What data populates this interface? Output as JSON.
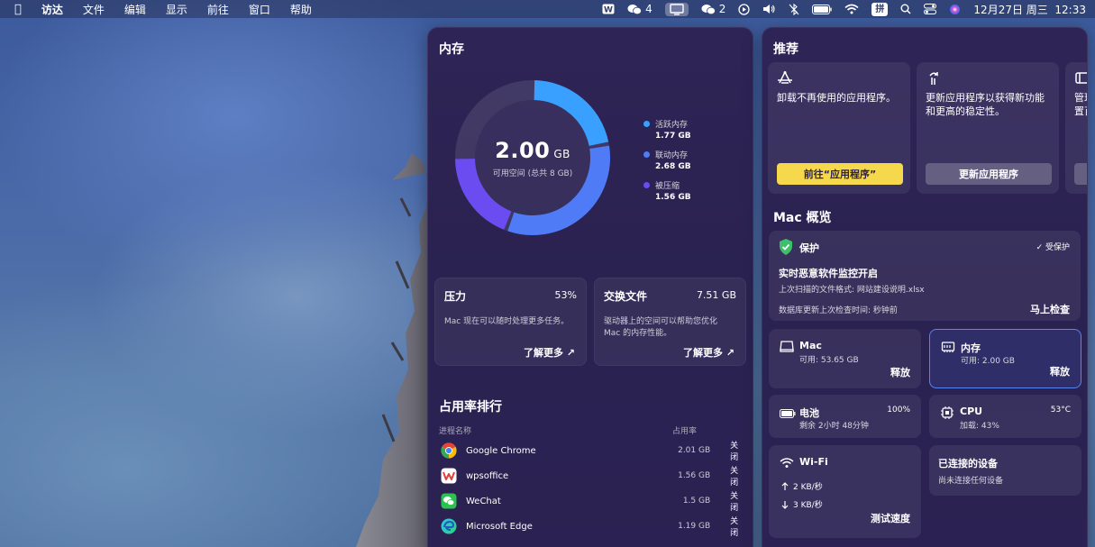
{
  "menubar": {
    "app_name": "访达",
    "menus": [
      "文件",
      "编辑",
      "显示",
      "前往",
      "窗口",
      "帮助"
    ],
    "wechat_count_1": "4",
    "wechat_count_2": "2",
    "input_method": "拼",
    "datetime": "12月27日 周三  12:33"
  },
  "memory": {
    "title": "内存",
    "available_value": "2.00",
    "available_unit": "GB",
    "available_caption": "可用空间 (总共 8 GB)",
    "legend": [
      {
        "label": "活跃内存",
        "value": "1.77 GB",
        "color": "#3aa0ff"
      },
      {
        "label": "联动内存",
        "value": "2.68 GB",
        "color": "#4f7cf6"
      },
      {
        "label": "被压缩",
        "value": "1.56 GB",
        "color": "#6a4cf0"
      }
    ],
    "gauge": {
      "active_gb": 1.77,
      "wired_gb": 2.68,
      "compressed_gb": 1.56,
      "free_gb": 2.0,
      "total_gb": 8
    }
  },
  "pressure": {
    "title": "压力",
    "value": "53%",
    "desc": "Mac 现在可以随时处理更多任务。",
    "link": "了解更多 ↗"
  },
  "swap": {
    "title": "交换文件",
    "value": "7.51 GB",
    "desc_line1": "驱动器上的空间可以帮助您优化",
    "desc_line2": "Mac 的内存性能。",
    "link": "了解更多 ↗"
  },
  "ranking": {
    "title": "占用率排行",
    "col_name": "进程名称",
    "col_usage": "占用率",
    "rows": [
      {
        "name": "Google Chrome",
        "usage": "2.01 GB",
        "action": "关闭",
        "icon": "chrome-icon"
      },
      {
        "name": "wpsoffice",
        "usage": "1.56 GB",
        "action": "关闭",
        "icon": "wps-icon"
      },
      {
        "name": "WeChat",
        "usage": "1.5 GB",
        "action": "关闭",
        "icon": "wechat-icon"
      },
      {
        "name": "Microsoft Edge",
        "usage": "1.19 GB",
        "action": "关闭",
        "icon": "edge-icon"
      }
    ]
  },
  "recommend": {
    "title": "推荐",
    "cards": [
      {
        "text": "卸载不再使用的应用程序。",
        "button": "前往“应用程序”"
      },
      {
        "text": "更新应用程序以获得新功能和更高的稳定性。",
        "button": "更新应用程序"
      },
      {
        "text": "管理\n置百",
        "button": ""
      }
    ]
  },
  "overview": {
    "title": "Mac 概览",
    "protection": {
      "title": "保护",
      "status": "✓ 受保护",
      "headline": "实时恶意软件监控开启",
      "scan_line": "上次扫描的文件格式: 网站建设说明.xlsx",
      "db_line": "数据库更新上次检查时间:  秒钟前",
      "action": "马上检查"
    },
    "disk": {
      "title": "Mac",
      "sub": "可用: 53.65 GB",
      "action": "释放"
    },
    "memory": {
      "title": "内存",
      "sub": "可用: 2.00 GB",
      "action": "释放"
    },
    "battery": {
      "title": "电池",
      "sub": "剩余 2小时 48分钟",
      "value": "100%"
    },
    "cpu": {
      "title": "CPU",
      "sub": "加载: 43%",
      "value": "53°C"
    },
    "wifi": {
      "title": "Wi-Fi",
      "up": "2 KB/秒",
      "down": "3 KB/秒",
      "action": "测试速度"
    },
    "devices": {
      "title": "已连接的设备",
      "sub": "尚未连接任何设备"
    }
  }
}
